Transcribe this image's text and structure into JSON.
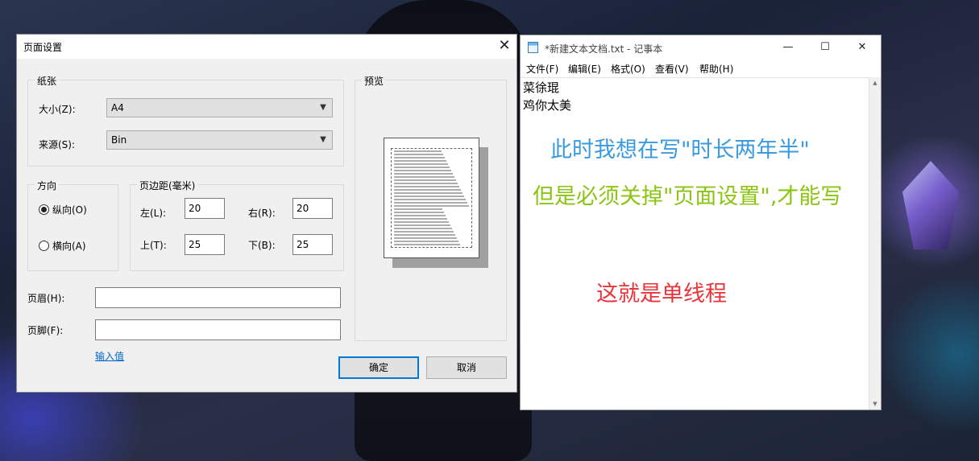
{
  "dialog": {
    "title": "页面设置",
    "close_glyph": "✕",
    "paper_group": "纸张",
    "size_label": "大小(Z):",
    "size_value": "A4",
    "source_label": "来源(S):",
    "source_value": "Bin",
    "orientation_group": "方向",
    "portrait_label": "纵向(O)",
    "landscape_label": "横向(A)",
    "orientation_selected": "portrait",
    "margins_group": "页边距(毫米)",
    "left_label": "左(L):",
    "left_value": "20",
    "right_label": "右(R):",
    "right_value": "20",
    "top_label": "上(T):",
    "top_value": "25",
    "bottom_label": "下(B):",
    "bottom_value": "25",
    "header_label": "页眉(H):",
    "header_value": "",
    "footer_label": "页脚(F):",
    "footer_value": "",
    "input_link": "输入值",
    "preview_group": "预览",
    "ok_label": "确定",
    "cancel_label": "取消"
  },
  "notepad": {
    "title": "*新建文本文档.txt - 记事本",
    "minimize_glyph": "—",
    "maximize_glyph": "☐",
    "close_glyph": "✕",
    "menu": [
      "文件(F)",
      "编辑(E)",
      "格式(O)",
      "查看(V)",
      "帮助(H)"
    ],
    "lines": [
      "菜徐琨",
      "鸡你太美"
    ]
  },
  "annotations": [
    {
      "text": "此时我想在写\"时长两年半\"",
      "color": "#3a9be0"
    },
    {
      "text": "但是必须关掉\"页面设置\",才能写",
      "color": "#8cc414"
    },
    {
      "text": "这就是单线程",
      "color": "#e8343a"
    }
  ]
}
